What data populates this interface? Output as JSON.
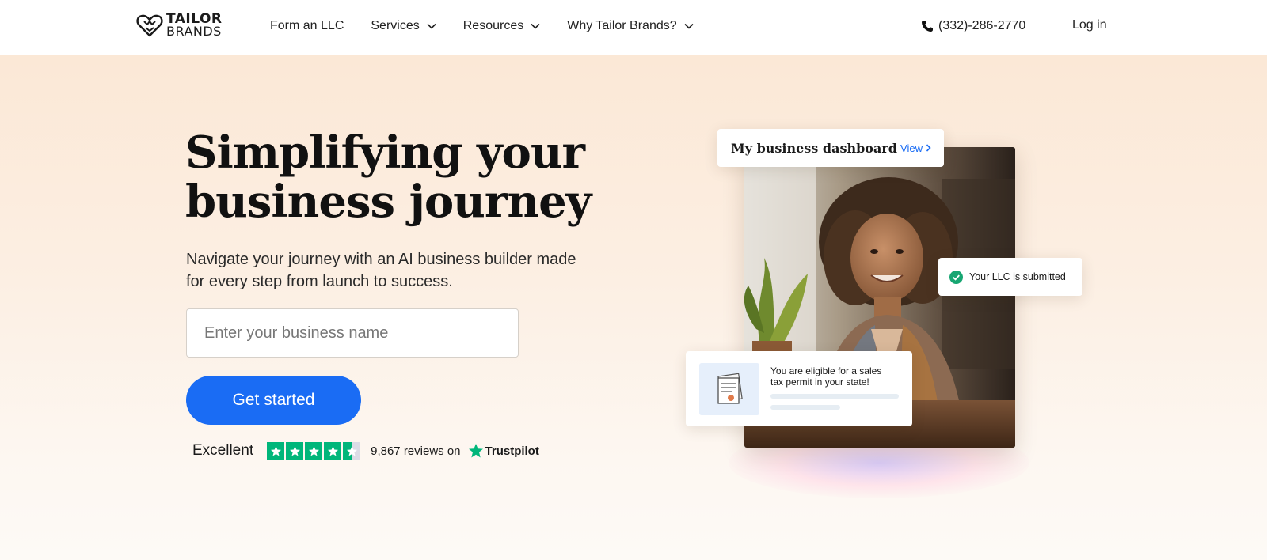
{
  "header": {
    "logo": {
      "line1": "TAILOR",
      "line2": "BRANDS"
    },
    "nav": [
      {
        "label": "Form an LLC",
        "has_dropdown": false
      },
      {
        "label": "Services",
        "has_dropdown": true
      },
      {
        "label": "Resources",
        "has_dropdown": true
      },
      {
        "label": "Why Tailor Brands?",
        "has_dropdown": true
      }
    ],
    "phone": "(332)-286-2770",
    "login_label": "Log in"
  },
  "hero": {
    "headline": "Simplifying your business journey",
    "subheadline": "Navigate your journey with an AI business builder made for every step from launch to success.",
    "input": {
      "placeholder": "Enter your business name",
      "value": ""
    },
    "cta_label": "Get started",
    "rating": {
      "word": "Excellent",
      "stars": 4.5,
      "reviews_text": "9,867 reviews on",
      "platform": "Trustpilot"
    }
  },
  "visual": {
    "dashboard_card": {
      "title": "My business dashboard",
      "link_label": "View"
    },
    "status_card": {
      "text": "Your LLC is submitted"
    },
    "tax_card": {
      "text": "You are eligible for a sales tax permit in your state!"
    }
  },
  "colors": {
    "accent": "#1a6cf4",
    "trustpilot_green": "#00b67a",
    "hero_bg_top": "#fbe8d6"
  },
  "icons": [
    "logo-heart-icon",
    "chevron-down-icon",
    "phone-icon",
    "star-icon",
    "trustpilot-star-icon",
    "chevron-right-icon",
    "check-circle-icon",
    "document-icon"
  ]
}
